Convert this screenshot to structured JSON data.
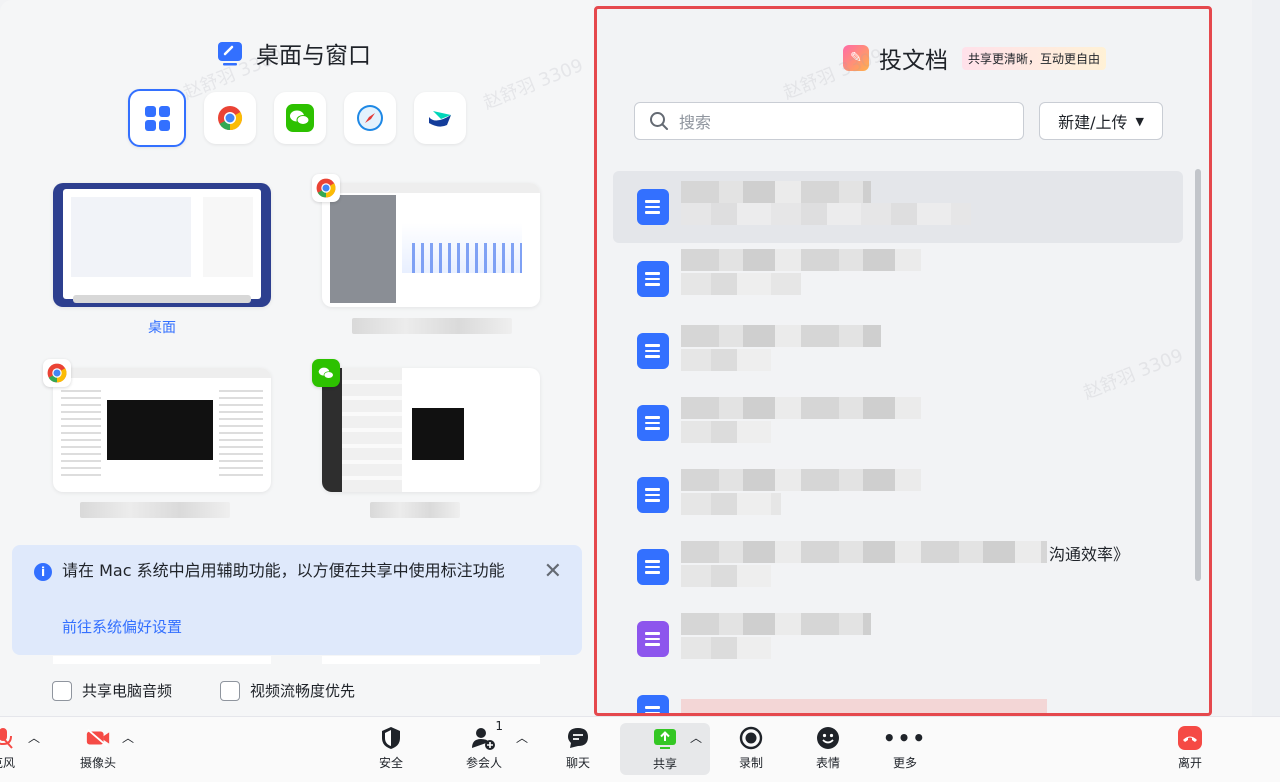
{
  "left_panel": {
    "title": "桌面与窗口",
    "apps": [
      "all-windows",
      "chrome",
      "wechat",
      "safari",
      "feishu"
    ],
    "thumbnails": [
      {
        "label": "桌面"
      },
      {
        "label": ""
      },
      {
        "label": ""
      },
      {
        "label": ""
      }
    ],
    "notice": {
      "message": "请在 Mac 系统中启用辅助功能，以方便在共享中使用标注功能",
      "link": "前往系统偏好设置"
    },
    "checkboxes": [
      {
        "label": "共享电脑音频",
        "checked": false
      },
      {
        "label": "视频流畅度优先",
        "checked": false
      }
    ]
  },
  "right_panel": {
    "title": "投文档",
    "tag": "共享更清晰，互动更自由",
    "search_placeholder": "搜索",
    "new_button": "新建/上传",
    "visible_doc_text": "沟通效率》"
  },
  "toolbar": {
    "mic": "克风",
    "camera": "摄像头",
    "security": "安全",
    "participants": "参会人",
    "participants_count": "1",
    "chat": "聊天",
    "share": "共享",
    "record": "录制",
    "reaction": "表情",
    "more": "更多",
    "leave": "离开"
  },
  "watermark": "赵舒羽 3309",
  "colors": {
    "accent": "#3370ff",
    "highlight_border": "#e5484d",
    "leave": "#f54a45",
    "share_green": "#34c724"
  }
}
